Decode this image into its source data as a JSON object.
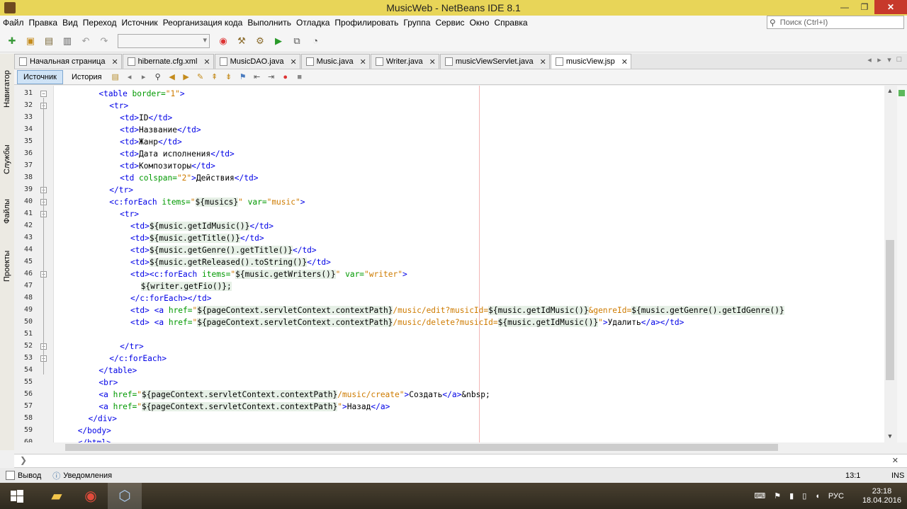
{
  "window": {
    "title": "MusicWeb - NetBeans IDE 8.1",
    "min_label": "—",
    "max_label": "❐",
    "close_label": "✕"
  },
  "menu": [
    "Файл",
    "Правка",
    "Вид",
    "Переход",
    "Источник",
    "Реорганизация кода",
    "Выполнить",
    "Отладка",
    "Профилировать",
    "Группа",
    "Сервис",
    "Окно",
    "Справка"
  ],
  "search": {
    "placeholder": "Поиск (Ctrl+I)"
  },
  "sidebar": {
    "tabs": [
      "Навигатор",
      "Службы",
      "Файлы",
      "Проекты"
    ]
  },
  "tabs": [
    {
      "label": "Начальная страница",
      "active": false
    },
    {
      "label": "hibernate.cfg.xml",
      "active": false
    },
    {
      "label": "MusicDAO.java",
      "active": false
    },
    {
      "label": "Music.java",
      "active": false
    },
    {
      "label": "Writer.java",
      "active": false
    },
    {
      "label": "musicViewServlet.java",
      "active": false
    },
    {
      "label": "musicView.jsp",
      "active": true
    }
  ],
  "editor_toolbar": {
    "source_label": "Источник",
    "history_label": "История"
  },
  "code_lines": [
    {
      "n": "31",
      "indent": 16,
      "parts": [
        [
          "tag",
          "<table "
        ],
        [
          "attr",
          "border="
        ],
        [
          "val",
          "\"1\""
        ],
        [
          "tag",
          ">"
        ]
      ]
    },
    {
      "n": "32",
      "indent": 20,
      "parts": [
        [
          "tag",
          "<tr>"
        ]
      ]
    },
    {
      "n": "33",
      "indent": 24,
      "parts": [
        [
          "tag",
          "<td>"
        ],
        [
          "txt",
          "ID"
        ],
        [
          "tag",
          "</td>"
        ]
      ]
    },
    {
      "n": "34",
      "indent": 24,
      "parts": [
        [
          "tag",
          "<td>"
        ],
        [
          "txt",
          "Название"
        ],
        [
          "tag",
          "</td>"
        ]
      ]
    },
    {
      "n": "35",
      "indent": 24,
      "parts": [
        [
          "tag",
          "<td>"
        ],
        [
          "txt",
          "Жанр"
        ],
        [
          "tag",
          "</td>"
        ]
      ]
    },
    {
      "n": "36",
      "indent": 24,
      "parts": [
        [
          "tag",
          "<td>"
        ],
        [
          "txt",
          "Дата исполнения"
        ],
        [
          "tag",
          "</td>"
        ]
      ]
    },
    {
      "n": "37",
      "indent": 24,
      "parts": [
        [
          "tag",
          "<td>"
        ],
        [
          "txt",
          "Композиторы"
        ],
        [
          "tag",
          "</td>"
        ]
      ]
    },
    {
      "n": "38",
      "indent": 24,
      "parts": [
        [
          "tag",
          "<td "
        ],
        [
          "attr",
          "colspan="
        ],
        [
          "val",
          "\"2\""
        ],
        [
          "tag",
          ">"
        ],
        [
          "txt",
          "Действия"
        ],
        [
          "tag",
          "</td>"
        ]
      ]
    },
    {
      "n": "39",
      "indent": 20,
      "parts": [
        [
          "tag",
          "</tr>"
        ]
      ]
    },
    {
      "n": "40",
      "indent": 20,
      "parts": [
        [
          "tag",
          "<c:forEach "
        ],
        [
          "attr",
          "items="
        ],
        [
          "val",
          "\""
        ],
        [
          "el",
          "${musics}"
        ],
        [
          "val",
          "\" "
        ],
        [
          "attr",
          "var="
        ],
        [
          "val",
          "\"music\""
        ],
        [
          "tag",
          ">"
        ]
      ]
    },
    {
      "n": "41",
      "indent": 24,
      "parts": [
        [
          "tag",
          "<tr>"
        ]
      ]
    },
    {
      "n": "42",
      "indent": 28,
      "parts": [
        [
          "tag",
          "<td>"
        ],
        [
          "el",
          "${music.getIdMusic()}"
        ],
        [
          "tag",
          "</td>"
        ]
      ]
    },
    {
      "n": "43",
      "indent": 28,
      "parts": [
        [
          "tag",
          "<td>"
        ],
        [
          "el",
          "${music.getTitle()}"
        ],
        [
          "tag",
          "</td>"
        ]
      ]
    },
    {
      "n": "44",
      "indent": 28,
      "parts": [
        [
          "tag",
          "<td>"
        ],
        [
          "el",
          "${music.getGenre().getTitle()}"
        ],
        [
          "tag",
          "</td>"
        ]
      ]
    },
    {
      "n": "45",
      "indent": 28,
      "parts": [
        [
          "tag",
          "<td>"
        ],
        [
          "el",
          "${music.getReleased().toString()}"
        ],
        [
          "tag",
          "</td>"
        ]
      ]
    },
    {
      "n": "46",
      "indent": 28,
      "parts": [
        [
          "tag",
          "<td><c:forEach "
        ],
        [
          "attr",
          "items="
        ],
        [
          "val",
          "\""
        ],
        [
          "el",
          "${music.getWriters()}"
        ],
        [
          "val",
          "\" "
        ],
        [
          "attr",
          "var="
        ],
        [
          "val",
          "\"writer\""
        ],
        [
          "tag",
          ">"
        ]
      ]
    },
    {
      "n": "47",
      "indent": 32,
      "parts": [
        [
          "el",
          "${writer.getFio()};"
        ]
      ]
    },
    {
      "n": "48",
      "indent": 28,
      "parts": [
        [
          "tag",
          "</c:forEach></td>"
        ]
      ]
    },
    {
      "n": "49",
      "indent": 28,
      "parts": [
        [
          "tag",
          "<td> <a "
        ],
        [
          "attr",
          "href="
        ],
        [
          "val",
          "\""
        ],
        [
          "el",
          "${pageContext.servletContext.contextPath}"
        ],
        [
          "val",
          "/music/edit?musicId="
        ],
        [
          "el",
          "${music.getIdMusic()}"
        ],
        [
          "val",
          "&genreId="
        ],
        [
          "el",
          "${music.getGenre().getIdGenre()}"
        ]
      ]
    },
    {
      "n": "50",
      "indent": 28,
      "parts": [
        [
          "tag",
          "<td> <a "
        ],
        [
          "attr",
          "href="
        ],
        [
          "val",
          "\""
        ],
        [
          "el",
          "${pageContext.servletContext.contextPath}"
        ],
        [
          "val",
          "/music/delete?musicId="
        ],
        [
          "el",
          "${music.getIdMusic()}"
        ],
        [
          "val",
          "\""
        ],
        [
          "tag",
          ">"
        ],
        [
          "txt",
          "Удалить"
        ],
        [
          "tag",
          "</a></td>"
        ]
      ]
    },
    {
      "n": "51",
      "indent": 0,
      "parts": []
    },
    {
      "n": "52",
      "indent": 24,
      "parts": [
        [
          "tag",
          "</tr>"
        ]
      ]
    },
    {
      "n": "53",
      "indent": 20,
      "parts": [
        [
          "tag",
          "</c:forEach>"
        ]
      ]
    },
    {
      "n": "54",
      "indent": 16,
      "parts": [
        [
          "tag",
          "</table>"
        ]
      ]
    },
    {
      "n": "55",
      "indent": 16,
      "parts": [
        [
          "tag",
          "<br>"
        ]
      ]
    },
    {
      "n": "56",
      "indent": 16,
      "parts": [
        [
          "tag",
          "<a "
        ],
        [
          "attr",
          "href="
        ],
        [
          "val",
          "\""
        ],
        [
          "el",
          "${pageContext.servletContext.contextPath}"
        ],
        [
          "val",
          "/music/create\""
        ],
        [
          "tag",
          ">"
        ],
        [
          "txt",
          "Создать"
        ],
        [
          "tag",
          "</a>"
        ],
        [
          "txt",
          "&nbsp;"
        ]
      ]
    },
    {
      "n": "57",
      "indent": 16,
      "parts": [
        [
          "tag",
          "<a "
        ],
        [
          "attr",
          "href="
        ],
        [
          "val",
          "\""
        ],
        [
          "el",
          "${pageContext.servletContext.contextPath}"
        ],
        [
          "val",
          "\""
        ],
        [
          "tag",
          ">"
        ],
        [
          "txt",
          "Назад"
        ],
        [
          "tag",
          "</a>"
        ]
      ]
    },
    {
      "n": "58",
      "indent": 12,
      "parts": [
        [
          "tag",
          "</div>"
        ]
      ]
    },
    {
      "n": "59",
      "indent": 8,
      "parts": [
        [
          "tag",
          "</body>"
        ]
      ]
    },
    {
      "n": "60",
      "indent": 8,
      "parts": [
        [
          "tag",
          "</html>"
        ]
      ]
    }
  ],
  "fold_lines": [
    "31",
    "32",
    "39",
    "40",
    "41",
    "46",
    "52",
    "53"
  ],
  "statusbar": {
    "output_label": "Вывод",
    "notifications_label": "Уведомления",
    "caret": "13:1",
    "mode": "INS"
  },
  "taskbar": {
    "lang": "РУС",
    "time": "23:18",
    "date": "18.04.2016"
  }
}
